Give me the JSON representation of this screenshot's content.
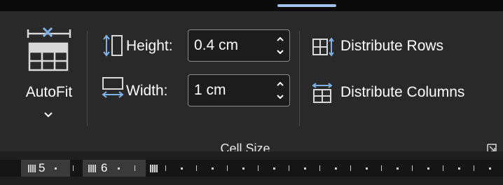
{
  "ribbon": {
    "autofit": {
      "label": "AutoFit",
      "icon": "table-autofit-icon"
    },
    "height": {
      "label": "Height:",
      "value": "0.4 cm",
      "icon": "row-height-icon"
    },
    "width": {
      "label": "Width:",
      "value": "1 cm",
      "icon": "column-width-icon"
    },
    "distribute_rows": {
      "label": "Distribute Rows",
      "icon": "distribute-rows-icon"
    },
    "distribute_columns": {
      "label": "Distribute Columns",
      "icon": "distribute-columns-icon"
    },
    "group_label": "Cell Size",
    "launcher_icon": "dialog-launcher-icon"
  },
  "ruler": {
    "numbers": [
      "5",
      "6"
    ]
  },
  "colors": {
    "accent": "#9ec3f0",
    "ribbon_bg": "#292929",
    "field_border": "#8a8a8a",
    "icon_blue": "#7fb2e6"
  }
}
